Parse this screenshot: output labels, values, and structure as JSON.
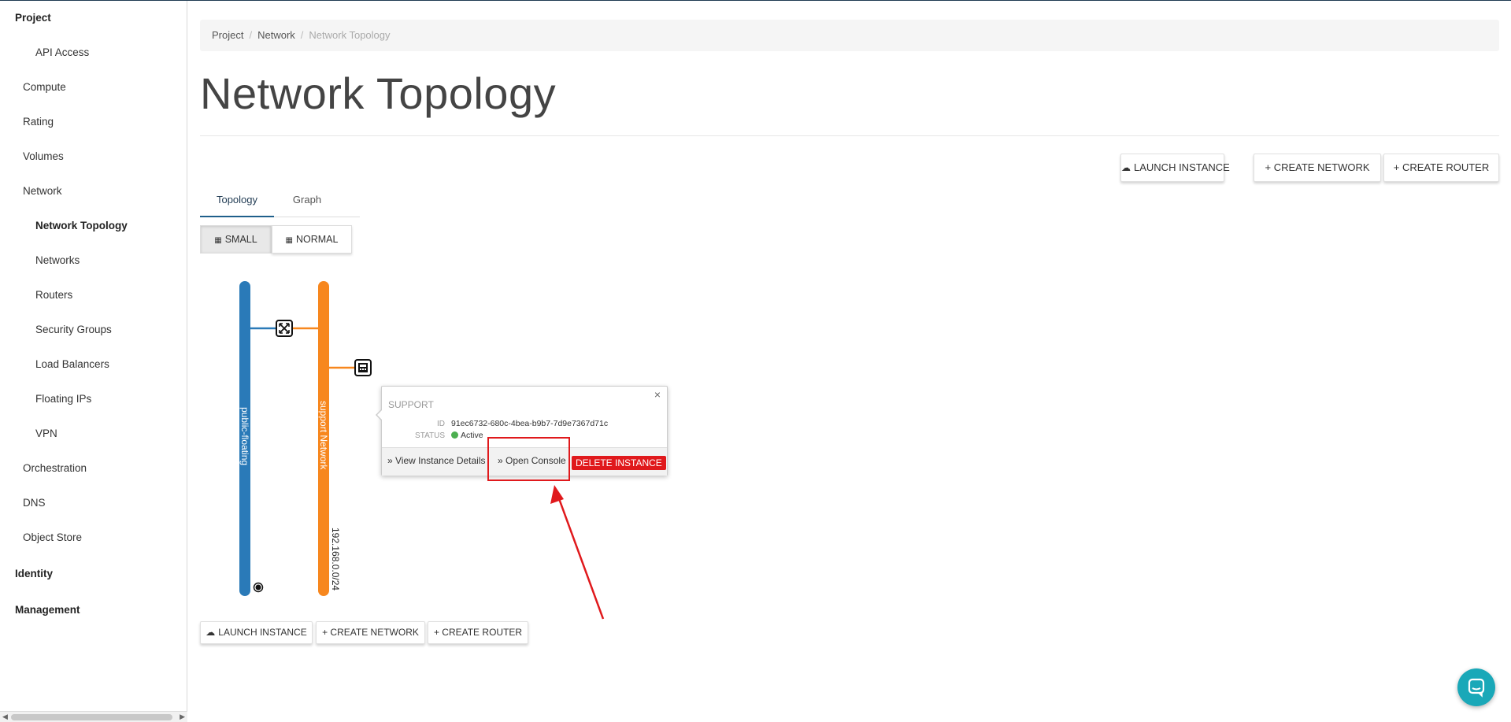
{
  "sidebar": {
    "items": [
      {
        "label": "Project",
        "level": 0
      },
      {
        "label": "API Access",
        "level": 2
      },
      {
        "label": "Compute",
        "level": 1
      },
      {
        "label": "Rating",
        "level": 1
      },
      {
        "label": "Volumes",
        "level": 1
      },
      {
        "label": "Network",
        "level": 1
      },
      {
        "label": "Network Topology",
        "level": 2,
        "active": true
      },
      {
        "label": "Networks",
        "level": 2
      },
      {
        "label": "Routers",
        "level": 2
      },
      {
        "label": "Security Groups",
        "level": 2
      },
      {
        "label": "Load Balancers",
        "level": 2
      },
      {
        "label": "Floating IPs",
        "level": 2
      },
      {
        "label": "VPN",
        "level": 2
      },
      {
        "label": "Orchestration",
        "level": 1
      },
      {
        "label": "DNS",
        "level": 1
      },
      {
        "label": "Object Store",
        "level": 1
      },
      {
        "label": "Identity",
        "level": 0
      },
      {
        "label": "Management",
        "level": 0
      }
    ]
  },
  "breadcrumb": [
    "Project",
    "Network",
    "Network Topology"
  ],
  "page_title": "Network Topology",
  "actions": {
    "launch_instance": "LAUNCH INSTANCE",
    "create_network": "+ CREATE NETWORK",
    "create_router": "+ CREATE ROUTER"
  },
  "tabs": [
    "Topology",
    "Graph"
  ],
  "size_toggle": {
    "small": "SMALL",
    "normal": "NORMAL",
    "selected": "SMALL"
  },
  "topology": {
    "networks": [
      {
        "name": "public-floating",
        "color": "#2a7ab8"
      },
      {
        "name": "support Network",
        "color": "#f7871e",
        "cidr": "192.168.0.0/24"
      }
    ],
    "router_icon": "router-icon",
    "instance_icon": "instance-icon",
    "external_icon": "globe-icon"
  },
  "popup": {
    "title": "SUPPORT",
    "id_label": "ID",
    "id_value": "91ec6732-680c-4bea-b9b7-7d9e7367d71c",
    "status_label": "STATUS",
    "status_value": "Active",
    "close": "×",
    "view_details": "» View Instance Details",
    "open_console": "» Open Console",
    "delete": "DELETE INSTANCE"
  },
  "colors": {
    "public_network": "#2a7ab8",
    "private_network": "#f7871e",
    "danger": "#e0191c",
    "status_active": "#4caf50",
    "chat": "#1aa8b8"
  }
}
